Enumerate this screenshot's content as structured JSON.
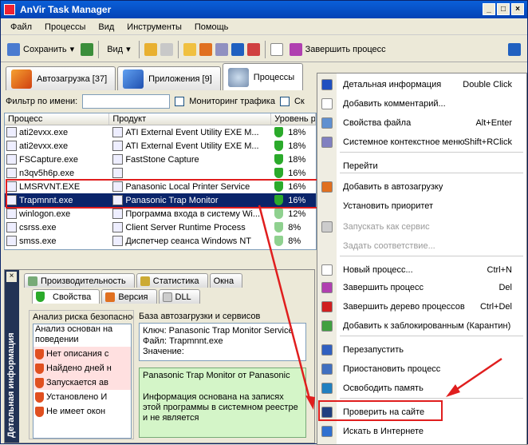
{
  "window": {
    "title": "AnVir Task Manager"
  },
  "menubar": [
    "Файл",
    "Процессы",
    "Вид",
    "Инструменты",
    "Помощь"
  ],
  "toolbar": {
    "save_label": "Сохранить",
    "view_label": "Вид",
    "kill_label": "Завершить процесс"
  },
  "tabs": [
    {
      "label": "Автозагрузка [37]"
    },
    {
      "label": "Приложения [9]"
    },
    {
      "label": "Процессы"
    }
  ],
  "filter": {
    "label": "Фильтр по имени:",
    "value": "",
    "traffic_label": "Мониторинг трафика",
    "extra_label": "Ск"
  },
  "grid": {
    "headers": [
      "Процесс",
      "Продукт",
      "Уровень р"
    ],
    "rows": [
      {
        "process": "ati2evxx.exe",
        "product": "ATI External Event Utility EXE M...",
        "level": "18%",
        "color": "#2BAA2B"
      },
      {
        "process": "ati2evxx.exe",
        "product": "ATI External Event Utility EXE M...",
        "level": "18%",
        "color": "#2BAA2B"
      },
      {
        "process": "FSCapture.exe",
        "product": "FastStone Capture",
        "level": "18%",
        "color": "#2BAA2B"
      },
      {
        "process": "n3qv5h6p.exe",
        "product": "",
        "level": "16%",
        "color": "#2BAA2B"
      },
      {
        "process": "LMSRVNT.EXE",
        "product": "Panasonic Local Printer Service",
        "level": "16%",
        "color": "#2BAA2B"
      },
      {
        "process": "Trapmnnt.exe",
        "product": "Panasonic Trap Monitor",
        "level": "16%",
        "color": "#2BAA2B"
      },
      {
        "process": "winlogon.exe",
        "product": "Программа входа в систему Wi...",
        "level": "12%",
        "color": "#8FD18F"
      },
      {
        "process": "csrss.exe",
        "product": "Client Server Runtime Process",
        "level": "8%",
        "color": "#8FD18F"
      },
      {
        "process": "smss.exe",
        "product": "Диспетчер сеанса  Windows NT",
        "level": "8%",
        "color": "#8FD18F"
      }
    ]
  },
  "details": {
    "sidebar_label": "Детальная информация",
    "tabs_row1": [
      "Производительность",
      "Статистика",
      "Окна"
    ],
    "tabs_row2": [
      "Свойства",
      "Версия",
      "DLL"
    ],
    "risk_title": "Анализ риска безопасности",
    "risk_subtitle": "Анализ основан на поведении",
    "risk_items": [
      "Нет описания с",
      "Найдено дней н",
      "Запускается ав",
      "Установлено И",
      "Не имеет окон"
    ],
    "db_title": "База автозагрузки и сервисов",
    "key_text": "Ключ: Panasonic Trap Monitor Service    Файл: Trapmnnt.exe\nЗначение:",
    "info_title": "Panasonic Trap Monitor от Panasonic",
    "info_text": "Информация основана на записях этой программы в системном реестре и не является"
  },
  "context_menu": {
    "items": [
      {
        "label": "Детальная информация",
        "key": "Double Click",
        "icon": "check-icon",
        "disabled": false
      },
      {
        "label": "Добавить комментарий...",
        "key": "",
        "icon": "comment-icon",
        "disabled": false
      },
      {
        "label": "Свойства файла",
        "key": "Alt+Enter",
        "icon": "magnifier-icon",
        "disabled": false
      },
      {
        "label": "Системное контекстное меню",
        "key": "Shift+RClick",
        "icon": "menu-icon",
        "disabled": false
      },
      {
        "label": "Перейти",
        "key": "",
        "icon": "",
        "disabled": false
      },
      {
        "label": "Добавить в автозагрузку",
        "key": "",
        "icon": "autorun-icon",
        "disabled": false
      },
      {
        "label": "Установить приоритет",
        "key": "",
        "icon": "",
        "disabled": false
      },
      {
        "label": "Запускать как сервис",
        "key": "",
        "icon": "service-icon",
        "disabled": true
      },
      {
        "label": "Задать соответствие...",
        "key": "",
        "icon": "",
        "disabled": true
      },
      {
        "label": "Новый процесс...",
        "key": "Ctrl+N",
        "icon": "new-process-icon",
        "disabled": false
      },
      {
        "label": "Завершить процесс",
        "key": "Del",
        "icon": "kill-icon",
        "disabled": false
      },
      {
        "label": "Завершить дерево процессов",
        "key": "Ctrl+Del",
        "icon": "kill-tree-icon",
        "disabled": false
      },
      {
        "label": "Добавить к заблокированным (Карантин)",
        "key": "",
        "icon": "quarantine-icon",
        "disabled": false
      },
      {
        "label": "Перезапустить",
        "key": "",
        "icon": "restart-icon",
        "disabled": false
      },
      {
        "label": "Приостановить процесс",
        "key": "",
        "icon": "pause-icon",
        "disabled": false
      },
      {
        "label": "Освободить память",
        "key": "",
        "icon": "memory-icon",
        "disabled": false
      },
      {
        "label": "Проверить на сайте",
        "key": "",
        "icon": "web-check-icon",
        "disabled": false
      },
      {
        "label": "Искать в Интернете",
        "key": "",
        "icon": "globe-icon",
        "disabled": false
      }
    ]
  }
}
